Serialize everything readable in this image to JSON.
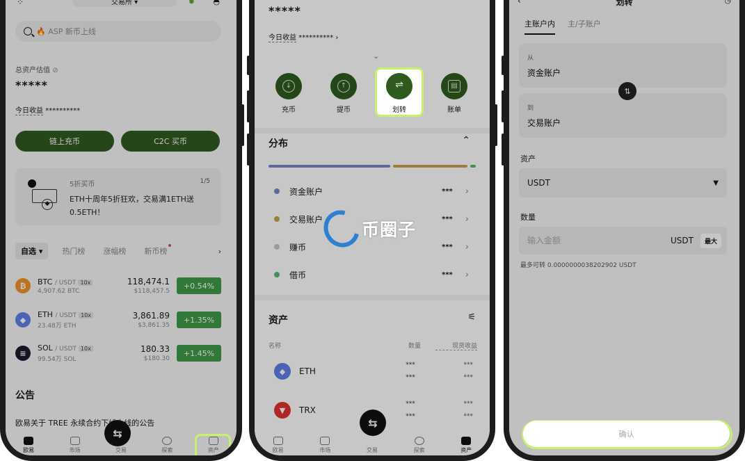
{
  "colors": {
    "accent_green": "#2f5a1f",
    "highlight": "#c6f26b",
    "up_green": "#3f9b4a",
    "bar_funding": "#7c86c8",
    "bar_trading": "#c9a24b",
    "bar_earn": "#c7c7c7",
    "bar_loan": "#58b86a",
    "watermark_blue": "#2d7fd0"
  },
  "phone1": {
    "top_title": "交易所",
    "search_placeholder": "🔥 ASP 新币上线",
    "total_label": "总资产估值",
    "total_value": "*****",
    "today_label": "今日收益",
    "today_value": "**********",
    "buttons": {
      "deposit": "链上充币",
      "c2c": "C2C 买币"
    },
    "promo": {
      "tag": "5折买币",
      "counter": "1/5",
      "line1": "ETH十周年5折狂欢，交易满1ETH送",
      "line2": "0.5ETH！"
    },
    "tabs": [
      "自选",
      "热门榜",
      "涨幅榜",
      "新币榜"
    ],
    "coins": [
      {
        "symbol": "BTC",
        "pair": "/ USDT",
        "lev": "10x",
        "vol": "4,907.62 BTC",
        "price": "118,474.1",
        "sub": "$118,457.5",
        "change": "+0.54%",
        "icon_text": "₿",
        "color": "#f0932b"
      },
      {
        "symbol": "ETH",
        "pair": "/ USDT",
        "lev": "10x",
        "vol": "23.48万 ETH",
        "price": "3,861.89",
        "sub": "$3,861.35",
        "change": "+1.35%",
        "icon_text": "◆",
        "color": "#627eea"
      },
      {
        "symbol": "SOL",
        "pair": "/ USDT",
        "lev": "10x",
        "vol": "99.54万 SOL",
        "price": "180.33",
        "sub": "$180.30",
        "change": "+1.45%",
        "icon_text": "≡",
        "color": "#1b1b2e"
      }
    ],
    "announce_title": "公告",
    "announce_text": "欧易关于 TREE 永续合约下线上线的公告",
    "nav": [
      "欧易",
      "市场",
      "交易",
      "探索",
      "资产"
    ]
  },
  "phone2": {
    "stars": "*****",
    "today_label": "今日收益",
    "today_value": "**********",
    "chevron": "›",
    "actions": [
      {
        "label": "充币",
        "glyph": "↓"
      },
      {
        "label": "提币",
        "glyph": "↑"
      },
      {
        "label": "划转",
        "glyph": "⇌"
      },
      {
        "label": "账单",
        "glyph": "▤"
      }
    ],
    "dist_title": "分布",
    "accounts": [
      {
        "name": "资金账户",
        "value": "***"
      },
      {
        "name": "交易账户",
        "value": "***"
      },
      {
        "name": "赚币",
        "value": "***"
      },
      {
        "name": "借币",
        "value": "***"
      }
    ],
    "assets_title": "资产",
    "cols": {
      "name": "名称",
      "qty": "数量",
      "pnl": "现货收益"
    },
    "assets": [
      {
        "name": "ETH",
        "q1": "***",
        "q2": "***",
        "e1": "***",
        "e2": "***"
      },
      {
        "name": "TRX",
        "q1": "***",
        "q2": "***",
        "e1": "***",
        "e2": "***"
      }
    ],
    "nav": [
      "欧易",
      "市场",
      "交易",
      "探索",
      "资产"
    ],
    "watermark": "币圈子"
  },
  "phone3": {
    "title": "划转",
    "tabs": [
      "主账户内",
      "主/子账户"
    ],
    "from_label": "从",
    "from_value": "资金账户",
    "to_label": "到",
    "to_value": "交易账户",
    "asset_label": "资产",
    "asset_value": "USDT",
    "amount_label": "数量",
    "amount_placeholder": "输入金额",
    "amount_unit": "USDT",
    "max_label": "最大",
    "available": "最多可转 0.0000000038202902 USDT",
    "confirm": "确认"
  }
}
